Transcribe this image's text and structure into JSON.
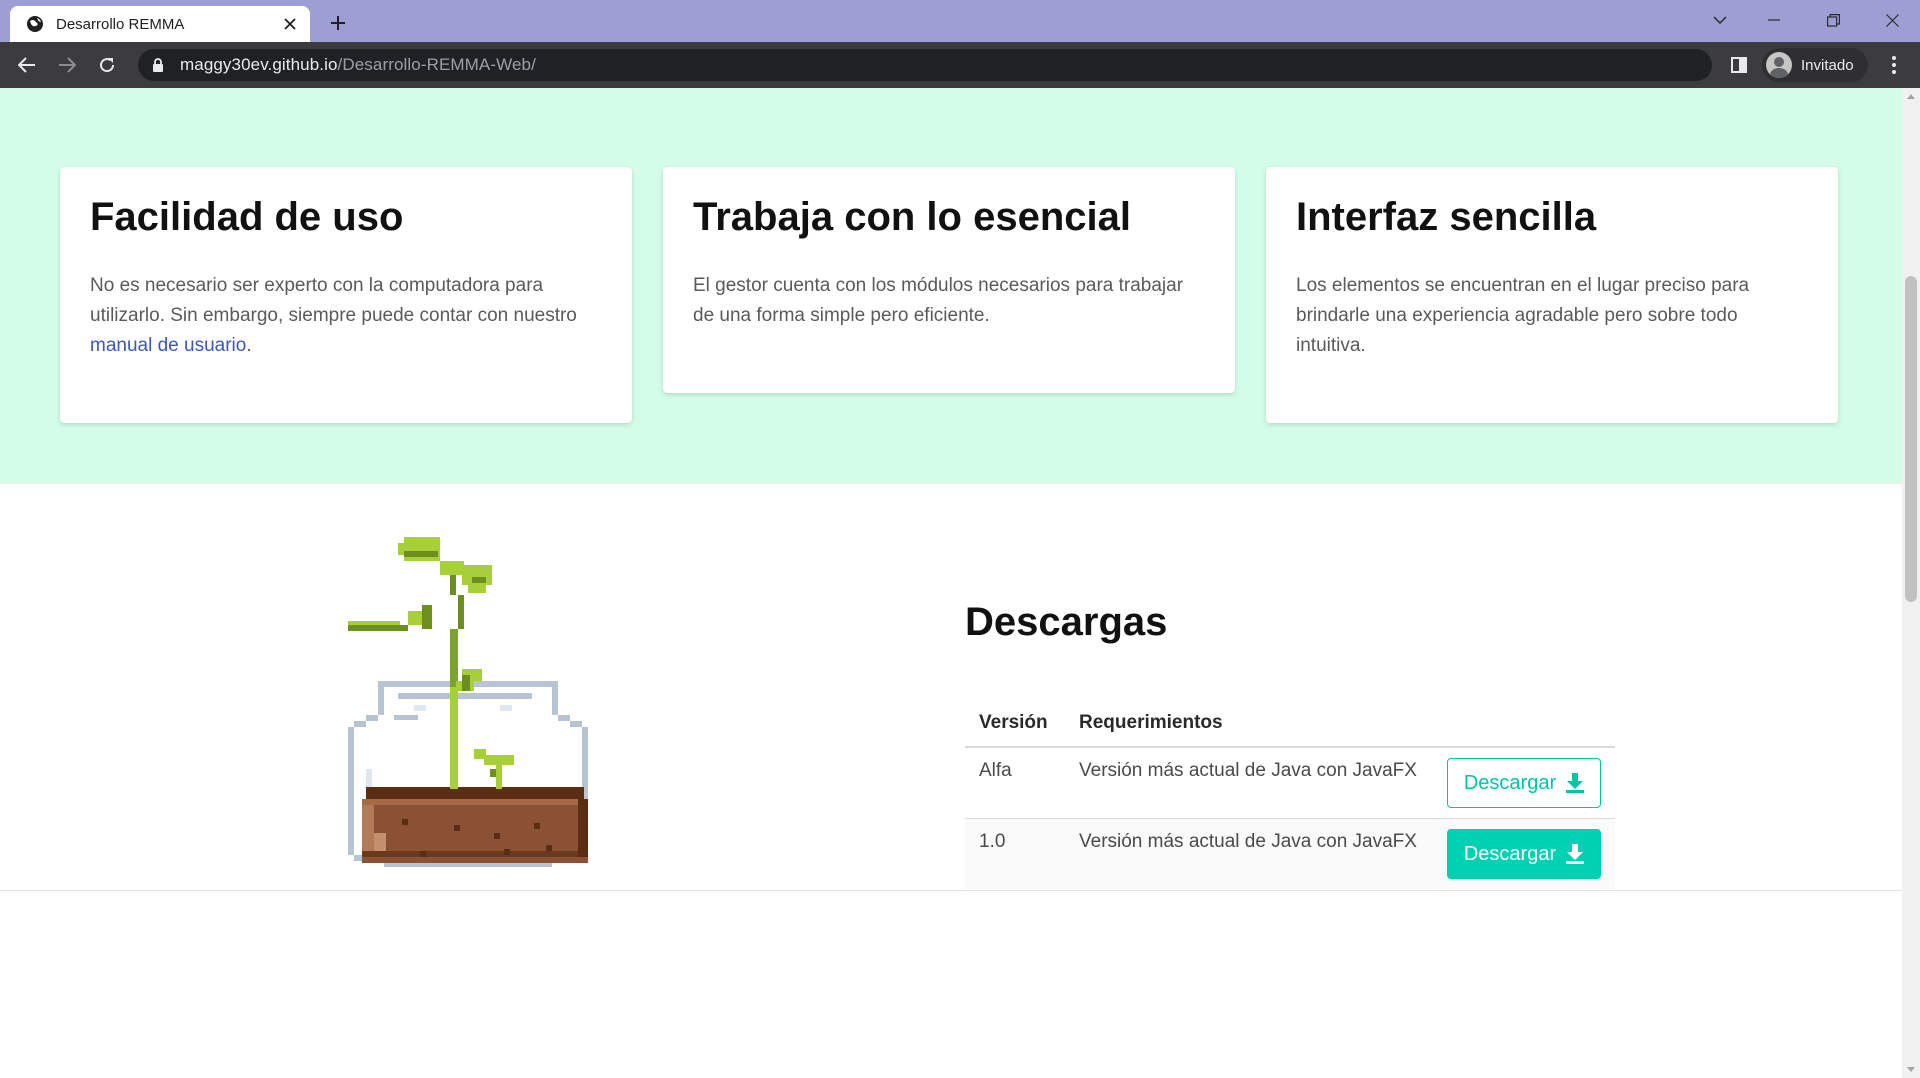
{
  "browser": {
    "tab_title": "Desarrollo REMMA",
    "url_host": "maggy30ev.github.io",
    "url_path": "/Desarrollo-REMMA-Web/",
    "profile_label": "Invitado"
  },
  "features": {
    "cards": [
      {
        "title": "Facilidad de uso",
        "text": "No es necesario ser experto con la computadora para utilizarlo. Sin embargo, siempre puede contar con nuestro ",
        "link": "manual de usuario",
        "text_after": "."
      },
      {
        "title": "Trabaja con lo esencial",
        "text": "El gestor cuenta con los módulos necesarios para trabajar de una forma simple pero eficiente."
      },
      {
        "title": "Interfaz sencilla",
        "text": "Los elementos se encuentran en el lugar preciso para brindarle una experiencia agradable pero sobre todo intuitiva."
      }
    ]
  },
  "downloads": {
    "title": "Descargas",
    "columns": [
      "Versión",
      "Requerimientos"
    ],
    "rows": [
      {
        "version": "Alfa",
        "requirements": "Versión más actual de Java con JavaFX",
        "button": "Descargar"
      },
      {
        "version": "1.0",
        "requirements": "Versión más actual de Java con JavaFX",
        "button": "Descargar"
      }
    ]
  },
  "colors": {
    "tabstrip": "#9d9fd4",
    "features_bg": "#d3fde8",
    "accent": "#00d1b2",
    "link": "#3c57b7"
  }
}
